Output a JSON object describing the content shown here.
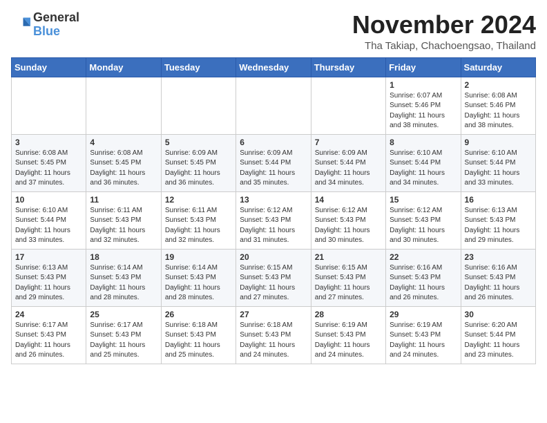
{
  "header": {
    "logo_line1": "General",
    "logo_line2": "Blue",
    "month_title": "November 2024",
    "subtitle": "Tha Takiap, Chachoengsao, Thailand"
  },
  "weekdays": [
    "Sunday",
    "Monday",
    "Tuesday",
    "Wednesday",
    "Thursday",
    "Friday",
    "Saturday"
  ],
  "weeks": [
    [
      {
        "day": "",
        "info": ""
      },
      {
        "day": "",
        "info": ""
      },
      {
        "day": "",
        "info": ""
      },
      {
        "day": "",
        "info": ""
      },
      {
        "day": "",
        "info": ""
      },
      {
        "day": "1",
        "info": "Sunrise: 6:07 AM\nSunset: 5:46 PM\nDaylight: 11 hours\nand 38 minutes."
      },
      {
        "day": "2",
        "info": "Sunrise: 6:08 AM\nSunset: 5:46 PM\nDaylight: 11 hours\nand 38 minutes."
      }
    ],
    [
      {
        "day": "3",
        "info": "Sunrise: 6:08 AM\nSunset: 5:45 PM\nDaylight: 11 hours\nand 37 minutes."
      },
      {
        "day": "4",
        "info": "Sunrise: 6:08 AM\nSunset: 5:45 PM\nDaylight: 11 hours\nand 36 minutes."
      },
      {
        "day": "5",
        "info": "Sunrise: 6:09 AM\nSunset: 5:45 PM\nDaylight: 11 hours\nand 36 minutes."
      },
      {
        "day": "6",
        "info": "Sunrise: 6:09 AM\nSunset: 5:44 PM\nDaylight: 11 hours\nand 35 minutes."
      },
      {
        "day": "7",
        "info": "Sunrise: 6:09 AM\nSunset: 5:44 PM\nDaylight: 11 hours\nand 34 minutes."
      },
      {
        "day": "8",
        "info": "Sunrise: 6:10 AM\nSunset: 5:44 PM\nDaylight: 11 hours\nand 34 minutes."
      },
      {
        "day": "9",
        "info": "Sunrise: 6:10 AM\nSunset: 5:44 PM\nDaylight: 11 hours\nand 33 minutes."
      }
    ],
    [
      {
        "day": "10",
        "info": "Sunrise: 6:10 AM\nSunset: 5:44 PM\nDaylight: 11 hours\nand 33 minutes."
      },
      {
        "day": "11",
        "info": "Sunrise: 6:11 AM\nSunset: 5:43 PM\nDaylight: 11 hours\nand 32 minutes."
      },
      {
        "day": "12",
        "info": "Sunrise: 6:11 AM\nSunset: 5:43 PM\nDaylight: 11 hours\nand 32 minutes."
      },
      {
        "day": "13",
        "info": "Sunrise: 6:12 AM\nSunset: 5:43 PM\nDaylight: 11 hours\nand 31 minutes."
      },
      {
        "day": "14",
        "info": "Sunrise: 6:12 AM\nSunset: 5:43 PM\nDaylight: 11 hours\nand 30 minutes."
      },
      {
        "day": "15",
        "info": "Sunrise: 6:12 AM\nSunset: 5:43 PM\nDaylight: 11 hours\nand 30 minutes."
      },
      {
        "day": "16",
        "info": "Sunrise: 6:13 AM\nSunset: 5:43 PM\nDaylight: 11 hours\nand 29 minutes."
      }
    ],
    [
      {
        "day": "17",
        "info": "Sunrise: 6:13 AM\nSunset: 5:43 PM\nDaylight: 11 hours\nand 29 minutes."
      },
      {
        "day": "18",
        "info": "Sunrise: 6:14 AM\nSunset: 5:43 PM\nDaylight: 11 hours\nand 28 minutes."
      },
      {
        "day": "19",
        "info": "Sunrise: 6:14 AM\nSunset: 5:43 PM\nDaylight: 11 hours\nand 28 minutes."
      },
      {
        "day": "20",
        "info": "Sunrise: 6:15 AM\nSunset: 5:43 PM\nDaylight: 11 hours\nand 27 minutes."
      },
      {
        "day": "21",
        "info": "Sunrise: 6:15 AM\nSunset: 5:43 PM\nDaylight: 11 hours\nand 27 minutes."
      },
      {
        "day": "22",
        "info": "Sunrise: 6:16 AM\nSunset: 5:43 PM\nDaylight: 11 hours\nand 26 minutes."
      },
      {
        "day": "23",
        "info": "Sunrise: 6:16 AM\nSunset: 5:43 PM\nDaylight: 11 hours\nand 26 minutes."
      }
    ],
    [
      {
        "day": "24",
        "info": "Sunrise: 6:17 AM\nSunset: 5:43 PM\nDaylight: 11 hours\nand 26 minutes."
      },
      {
        "day": "25",
        "info": "Sunrise: 6:17 AM\nSunset: 5:43 PM\nDaylight: 11 hours\nand 25 minutes."
      },
      {
        "day": "26",
        "info": "Sunrise: 6:18 AM\nSunset: 5:43 PM\nDaylight: 11 hours\nand 25 minutes."
      },
      {
        "day": "27",
        "info": "Sunrise: 6:18 AM\nSunset: 5:43 PM\nDaylight: 11 hours\nand 24 minutes."
      },
      {
        "day": "28",
        "info": "Sunrise: 6:19 AM\nSunset: 5:43 PM\nDaylight: 11 hours\nand 24 minutes."
      },
      {
        "day": "29",
        "info": "Sunrise: 6:19 AM\nSunset: 5:43 PM\nDaylight: 11 hours\nand 24 minutes."
      },
      {
        "day": "30",
        "info": "Sunrise: 6:20 AM\nSunset: 5:44 PM\nDaylight: 11 hours\nand 23 minutes."
      }
    ]
  ]
}
